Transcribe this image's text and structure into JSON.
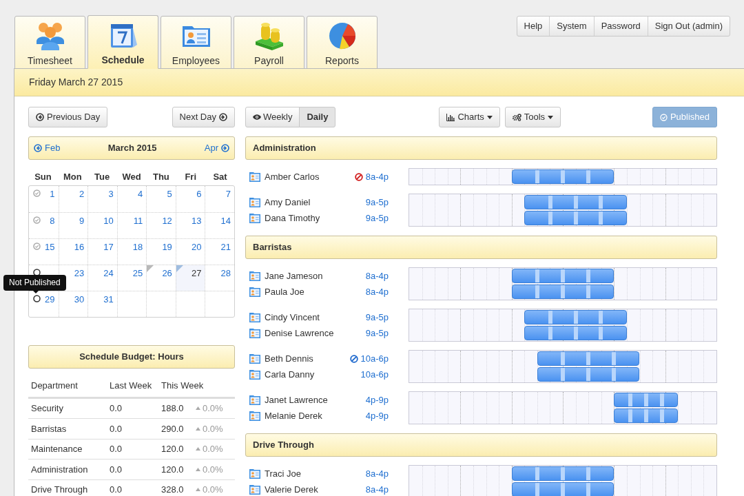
{
  "tabs": [
    {
      "label": "Timesheet",
      "kind": "timesheet",
      "selected": false
    },
    {
      "label": "Schedule",
      "kind": "schedule",
      "selected": true
    },
    {
      "label": "Employees",
      "kind": "employees",
      "selected": false
    },
    {
      "label": "Payroll",
      "kind": "payroll",
      "selected": false
    },
    {
      "label": "Reports",
      "kind": "reports",
      "selected": false
    }
  ],
  "top_menu": [
    "Help",
    "System",
    "Password",
    "Sign Out (admin)"
  ],
  "date_bar": "Friday March 27 2015",
  "day_nav": {
    "previous": "Previous Day",
    "next": "Next Day"
  },
  "view_toggle": [
    {
      "label": "Weekly",
      "kind": "weekly",
      "selected": false
    },
    {
      "label": "Daily",
      "kind": "daily",
      "selected": true
    }
  ],
  "toolbar": {
    "charts": "Charts",
    "tools": "Tools",
    "publish": "Published"
  },
  "calendar": {
    "prev": "Feb",
    "title": "March 2015",
    "next": "Apr",
    "weekdays": [
      "Sun",
      "Mon",
      "Tue",
      "Wed",
      "Thu",
      "Fri",
      "Sat"
    ],
    "weeks": [
      {
        "published": true,
        "days": [
          {
            "label": "1",
            "selected": false,
            "flagged": false
          },
          {
            "label": "2",
            "selected": false,
            "flagged": false
          },
          {
            "label": "3",
            "selected": false,
            "flagged": false
          },
          {
            "label": "4",
            "selected": false,
            "flagged": false
          },
          {
            "label": "5",
            "selected": false,
            "flagged": false
          },
          {
            "label": "6",
            "selected": false,
            "flagged": false
          },
          {
            "label": "7",
            "selected": false,
            "flagged": false
          }
        ]
      },
      {
        "published": true,
        "days": [
          {
            "label": "8",
            "selected": false,
            "flagged": false
          },
          {
            "label": "9",
            "selected": false,
            "flagged": false
          },
          {
            "label": "10",
            "selected": false,
            "flagged": false
          },
          {
            "label": "11",
            "selected": false,
            "flagged": false
          },
          {
            "label": "12",
            "selected": false,
            "flagged": false
          },
          {
            "label": "13",
            "selected": false,
            "flagged": false
          },
          {
            "label": "14",
            "selected": false,
            "flagged": false
          }
        ]
      },
      {
        "published": true,
        "days": [
          {
            "label": "15",
            "selected": false,
            "flagged": false
          },
          {
            "label": "16",
            "selected": false,
            "flagged": false
          },
          {
            "label": "17",
            "selected": false,
            "flagged": false
          },
          {
            "label": "18",
            "selected": false,
            "flagged": false
          },
          {
            "label": "19",
            "selected": false,
            "flagged": false
          },
          {
            "label": "20",
            "selected": false,
            "flagged": false
          },
          {
            "label": "21",
            "selected": false,
            "flagged": false
          }
        ]
      },
      {
        "published": false,
        "tooltip": "Not Published",
        "days": [
          {
            "selected": false,
            "flagged": false
          },
          {
            "label": "23",
            "selected": false,
            "flagged": false
          },
          {
            "label": "24",
            "selected": false,
            "flagged": false
          },
          {
            "label": "25",
            "selected": false,
            "flagged": false
          },
          {
            "label": "26",
            "selected": false,
            "flagged": true
          },
          {
            "label": "27",
            "selected": true,
            "flagged": false
          },
          {
            "label": "28",
            "selected": false,
            "flagged": false
          }
        ]
      },
      {
        "published": false,
        "days": [
          {
            "label": "29",
            "selected": false,
            "flagged": false
          },
          {
            "label": "30",
            "selected": false,
            "flagged": false
          },
          {
            "label": "31",
            "selected": false,
            "flagged": false
          }
        ]
      }
    ]
  },
  "budget": {
    "title": "Schedule Budget: Hours",
    "columns": [
      "Department",
      "Last Week",
      "This Week"
    ],
    "rows": [
      {
        "department": "Security",
        "last_week": "0.0",
        "this_week": "188.0",
        "change": "0.0%"
      },
      {
        "department": "Barristas",
        "last_week": "0.0",
        "this_week": "290.0",
        "change": "0.0%"
      },
      {
        "department": "Maintenance",
        "last_week": "0.0",
        "this_week": "120.0",
        "change": "0.0%"
      },
      {
        "department": "Administration",
        "last_week": "0.0",
        "this_week": "120.0",
        "change": "0.0%"
      },
      {
        "department": "Drive Through",
        "last_week": "0.0",
        "this_week": "328.0",
        "change": "0.0%"
      }
    ]
  },
  "schedule": [
    {
      "name": "Administration",
      "blocks": [
        [
          {
            "name": "Amber Carlos",
            "shift": "8a-4p",
            "blocked": true,
            "color": "#d01818"
          }
        ],
        [
          {
            "name": "Amy Daniel",
            "shift": "9a-5p",
            "blocked": false
          },
          {
            "name": "Dana Timothy",
            "shift": "9a-5p",
            "blocked": false
          }
        ]
      ]
    },
    {
      "name": "Barristas",
      "blocks": [
        [
          {
            "name": "Jane Jameson",
            "shift": "8a-4p",
            "blocked": false
          },
          {
            "name": "Paula Joe",
            "shift": "8a-4p",
            "blocked": false
          }
        ],
        [
          {
            "name": "Cindy Vincent",
            "shift": "9a-5p",
            "blocked": false
          },
          {
            "name": "Denise Lawrence",
            "shift": "9a-5p",
            "blocked": false
          }
        ],
        [
          {
            "name": "Beth Dennis",
            "shift": "10a-6p",
            "blocked": true,
            "color": "#1a66cc"
          },
          {
            "name": "Carla Danny",
            "shift": "10a-6p",
            "blocked": false
          }
        ],
        [
          {
            "name": "Janet Lawrence",
            "shift": "4p-9p",
            "blocked": false
          },
          {
            "name": "Melanie Derek",
            "shift": "4p-9p",
            "blocked": false
          }
        ]
      ]
    },
    {
      "name": "Drive Through",
      "blocks": [
        [
          {
            "name": "Traci Joe",
            "shift": "8a-4p",
            "blocked": false
          },
          {
            "name": "Valerie Derek",
            "shift": "8a-4p",
            "blocked": false
          }
        ]
      ]
    }
  ]
}
